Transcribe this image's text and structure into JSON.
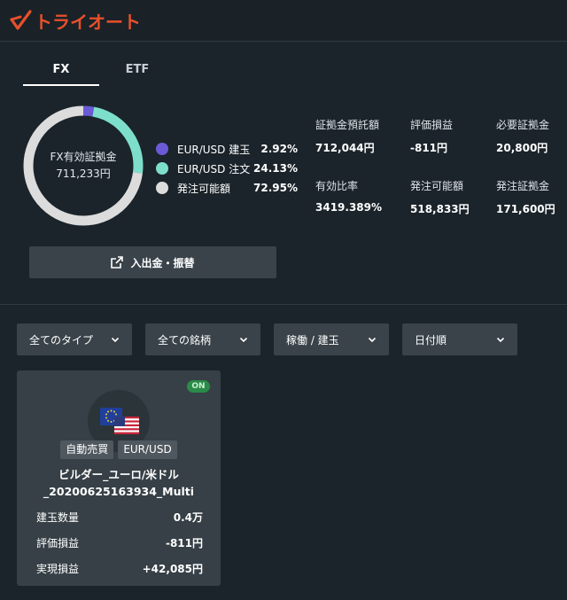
{
  "brand": {
    "name": "トライオート",
    "color": "#e8502a"
  },
  "tabs": [
    {
      "label": "FX",
      "active": true
    },
    {
      "label": "ETF",
      "active": false
    }
  ],
  "summary": {
    "donut_title": "FX有効証拠金",
    "donut_value": "711,233円",
    "legend": [
      {
        "name": "EUR/USD 建玉",
        "value": "2.92%",
        "color": "#6b5ad6"
      },
      {
        "name": "EUR/USD 注文",
        "value": "24.13%",
        "color": "#7ddfcb"
      },
      {
        "name": "発注可能額",
        "value": "72.95%",
        "color": "#dcdcdc"
      }
    ],
    "stats": [
      {
        "label": "証拠金預託額",
        "value": "712,044円"
      },
      {
        "label": "評価損益",
        "value": "-811円"
      },
      {
        "label": "必要証拠金",
        "value": "20,800円"
      },
      {
        "label": "有効比率",
        "value": "3419.389%"
      },
      {
        "label": "発注可能額",
        "value": "518,833円"
      },
      {
        "label": "発注証拠金",
        "value": "171,600円"
      }
    ],
    "transfer_button": "入出金・振替"
  },
  "chart_data": {
    "type": "pie",
    "categories": [
      "EUR/USD 建玉",
      "EUR/USD 注文",
      "発注可能額"
    ],
    "values": [
      2.92,
      24.13,
      72.95
    ],
    "colors": [
      "#6b5ad6",
      "#7ddfcb",
      "#dcdcdc"
    ]
  },
  "filters": [
    {
      "label": "全てのタイプ"
    },
    {
      "label": "全ての銘柄"
    },
    {
      "label": "稼働 / 建玉"
    },
    {
      "label": "日付順"
    }
  ],
  "card": {
    "status": "ON",
    "tags": [
      "自動売買",
      "EUR/USD"
    ],
    "title_line1": "ビルダー_ユーロ/米ドル",
    "title_line2": "_20200625163934_Multi",
    "rows": [
      {
        "label": "建玉数量",
        "value": "0.4万"
      },
      {
        "label": "評価損益",
        "value": "-811円"
      },
      {
        "label": "実現損益",
        "value": "+42,085円"
      }
    ]
  }
}
